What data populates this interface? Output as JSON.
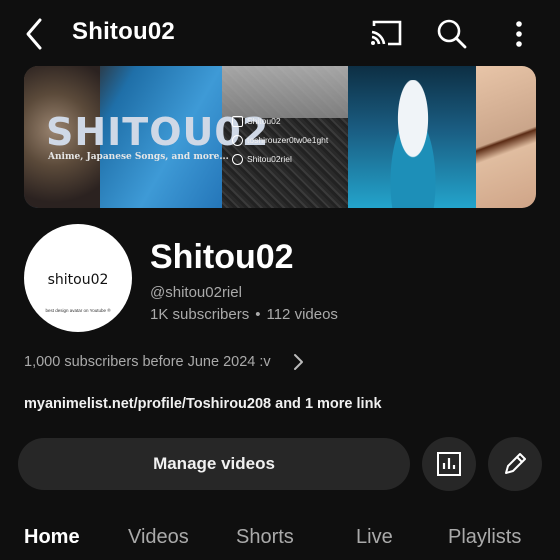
{
  "header": {
    "title": "Shitou02"
  },
  "banner": {
    "logo_text": "SHITOU02",
    "tagline": "Anime, Japanese Songs, and more...",
    "social": [
      {
        "icon": "youtube-icon",
        "text": "Shitou02"
      },
      {
        "icon": "globe-icon",
        "text": "toshirouzer0tw0e1ght"
      },
      {
        "icon": "twitter-icon",
        "text": "Shitou02riel"
      }
    ]
  },
  "avatar": {
    "name": "shitou02",
    "subtext": "best design avatar on Youtube ®"
  },
  "channel": {
    "name": "Shitou02",
    "handle": "@shitou02riel",
    "subscribers": "1K subscribers",
    "dot": "•",
    "videos": "112 videos",
    "description": "1,000 subscribers before June 2024 :v",
    "link": "myanimelist.net/profile/Toshirou208",
    "more_links": "and 1 more link"
  },
  "actions": {
    "manage_label": "Manage videos"
  },
  "tabs": [
    {
      "label": "Home",
      "active": true
    },
    {
      "label": "Videos",
      "active": false
    },
    {
      "label": "Shorts",
      "active": false
    },
    {
      "label": "Live",
      "active": false
    },
    {
      "label": "Playlists",
      "active": false
    }
  ],
  "colors": {
    "background": "#0f0f0f",
    "surface": "#272727",
    "text_primary": "#f1f1f1",
    "text_secondary": "#aaaaaa"
  }
}
